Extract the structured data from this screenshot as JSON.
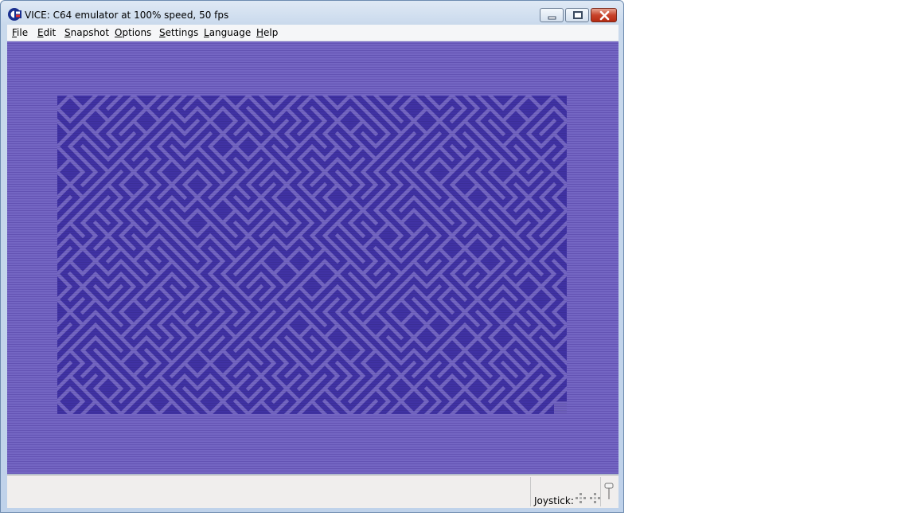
{
  "window": {
    "title": "VICE: C64 emulator at 100% speed, 50 fps",
    "icon": "commodore-logo-icon"
  },
  "controls": {
    "minimize": "minimize-icon",
    "maximize": "maximize-icon",
    "close": "close-icon"
  },
  "menu": {
    "items": [
      "File",
      "Edit",
      "Snapshot",
      "Options",
      "Settings",
      "Language",
      "Help"
    ]
  },
  "emulator": {
    "border_color": "#7466c3",
    "background_color": "#4032a4",
    "maze_color": "#7466c3",
    "content": "10 PRINT maze pattern"
  },
  "statusbar": {
    "joystick_label": "Joystick:"
  },
  "colors": {
    "close_red": "#c8432b",
    "frame_blue": "#bfd2ea"
  }
}
